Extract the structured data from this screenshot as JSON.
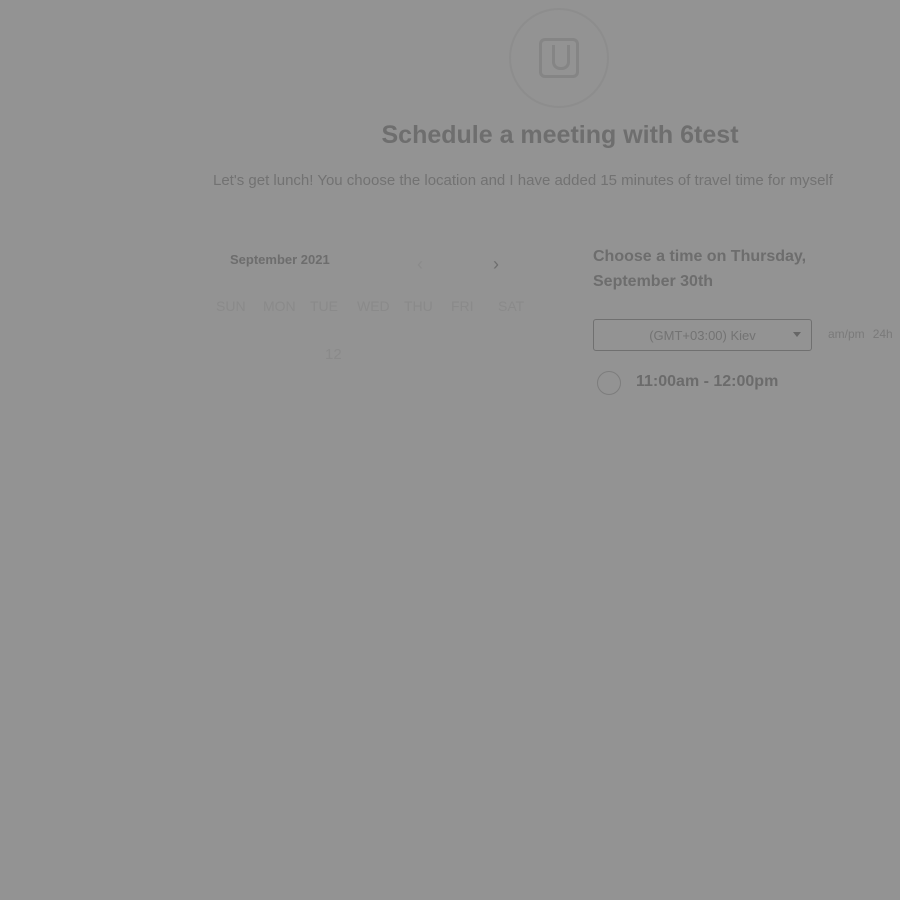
{
  "header": {
    "title": "Schedule a meeting with 6test",
    "description": "Let's get lunch! You choose the location and I have added 15 minutes of travel time for myself"
  },
  "avatar": {
    "icon": "logo-icon"
  },
  "calendar": {
    "month_label": "September 2021",
    "weekdays": [
      "SUN",
      "MON",
      "TUE",
      "WED",
      "THU",
      "FRI",
      "SAT"
    ],
    "visible_days": [
      "12"
    ]
  },
  "times": {
    "heading": "Choose a time on Thursday, September 30th",
    "timezone": "(GMT+03:00) Kiev",
    "format_options": [
      "am/pm",
      "24h"
    ],
    "slots": [
      "11:00am - 12:00pm"
    ]
  }
}
